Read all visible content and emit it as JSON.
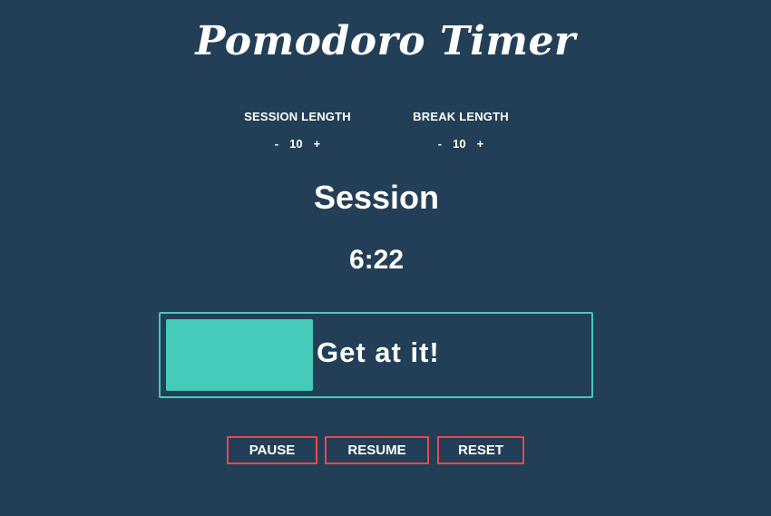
{
  "app": {
    "title": "Pomodoro Timer"
  },
  "settings": {
    "session": {
      "label": "SESSION LENGTH",
      "decrement": "-",
      "value": "10",
      "increment": "+"
    },
    "break": {
      "label": "BREAK LENGTH",
      "decrement": "-",
      "value": "10",
      "increment": "+"
    }
  },
  "timer": {
    "mode": "Session",
    "time_remaining": "6:22",
    "progress_fraction": 0.35,
    "message": "Get at it!"
  },
  "controls": {
    "pause_label": "PAUSE",
    "resume_label": "RESUME",
    "reset_label": "RESET"
  },
  "colors": {
    "background": "#223f57",
    "accent": "#46cbb9",
    "button_border": "#e8494a",
    "text": "#ffffff"
  }
}
